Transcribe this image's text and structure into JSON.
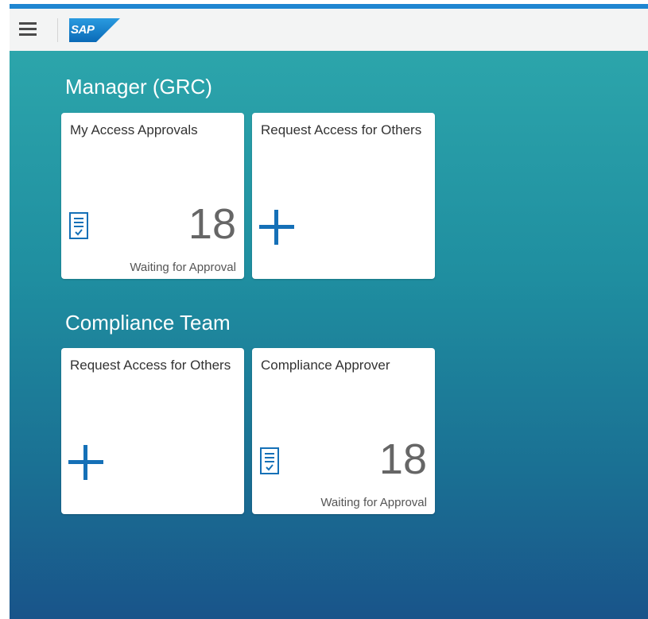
{
  "shell": {
    "brand": "SAP",
    "accent_color": "#1f86d1",
    "menu_icon": "hamburger-icon"
  },
  "groups": [
    {
      "title": "Manager (GRC)",
      "tiles": [
        {
          "title": "My Access Approvals",
          "icon": "approval-document-icon",
          "number": "18",
          "footer": "Waiting for Approval"
        },
        {
          "title": "Request Access for Others",
          "icon": "plus-icon"
        }
      ]
    },
    {
      "title": "Compliance Team",
      "tiles": [
        {
          "title": "Request Access for Others",
          "icon": "plus-icon"
        },
        {
          "title": "Compliance Approver",
          "icon": "approval-document-icon",
          "number": "18",
          "footer": "Waiting for Approval"
        }
      ]
    }
  ],
  "colors": {
    "tile_icon": "#1570b7",
    "background_top": "#2ca5ab",
    "background_bottom": "#19548a"
  }
}
